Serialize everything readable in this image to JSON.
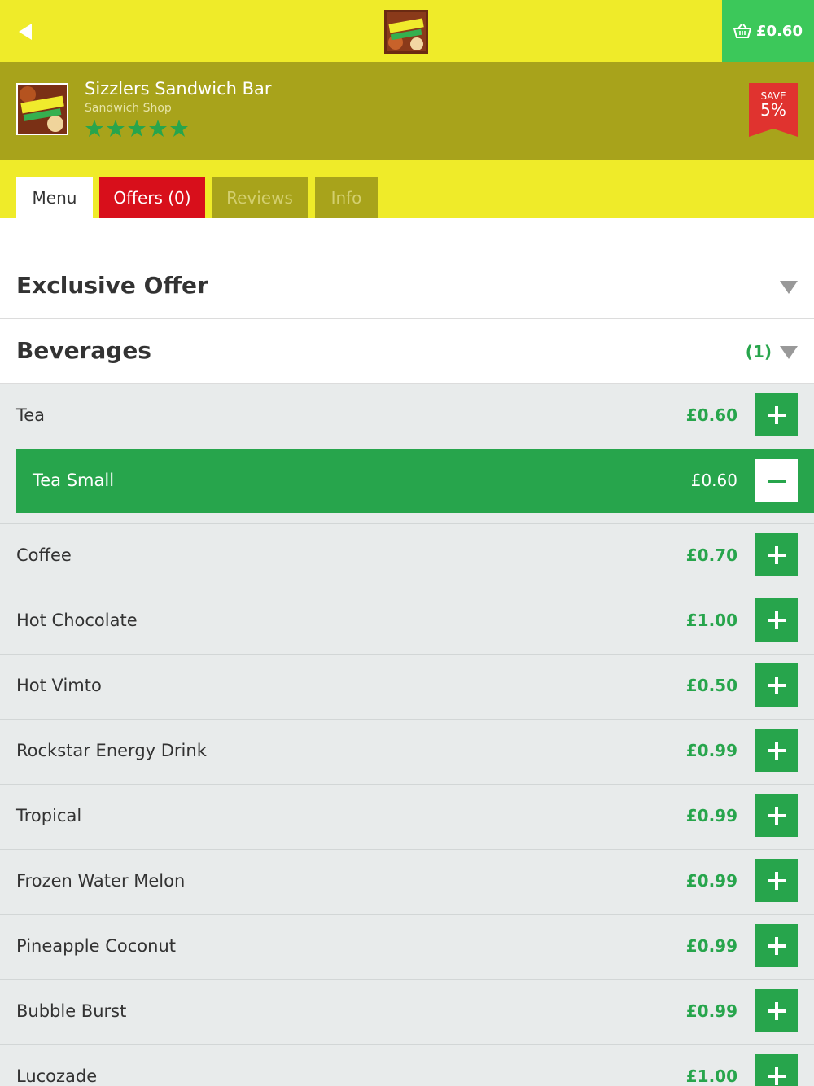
{
  "topbar": {
    "back_icon": "back-arrow-icon",
    "logo_icon": "sizzlers-logo-icon",
    "basket_icon": "basket-icon",
    "basket_total": "£0.60"
  },
  "shop": {
    "name": "Sizzlers Sandwich Bar",
    "type": "Sandwich Shop",
    "rating": 5,
    "rating_max": 5,
    "save_label": "SAVE",
    "save_percent": "5%"
  },
  "tabs": {
    "menu": "Menu",
    "offers": "Offers (0)",
    "reviews": "Reviews",
    "info": "Info"
  },
  "sections": {
    "exclusive": {
      "title": "Exclusive Offer"
    },
    "beverages": {
      "title": "Beverages",
      "count": "(1)"
    }
  },
  "items": [
    {
      "name": "Tea",
      "price": "£0.60"
    },
    {
      "name": "Coffee",
      "price": "£0.70"
    },
    {
      "name": "Hot Chocolate",
      "price": "£1.00"
    },
    {
      "name": "Hot Vimto",
      "price": "£0.50"
    },
    {
      "name": "Rockstar Energy Drink",
      "price": "£0.99"
    },
    {
      "name": "Tropical",
      "price": "£0.99"
    },
    {
      "name": "Frozen Water Melon",
      "price": "£0.99"
    },
    {
      "name": "Pineapple Coconut",
      "price": "£0.99"
    },
    {
      "name": "Bubble Burst",
      "price": "£0.99"
    },
    {
      "name": "Lucozade",
      "price": "£1.00"
    }
  ],
  "selected": {
    "name": "Tea Small",
    "price": "£0.60"
  },
  "colors": {
    "topbar": "#efeb29",
    "shopbar": "#a8a31b",
    "accent_green": "#27a54c",
    "basket_green": "#3cc85a",
    "offers_red": "#d80f1b",
    "save_red": "#e0332f"
  }
}
